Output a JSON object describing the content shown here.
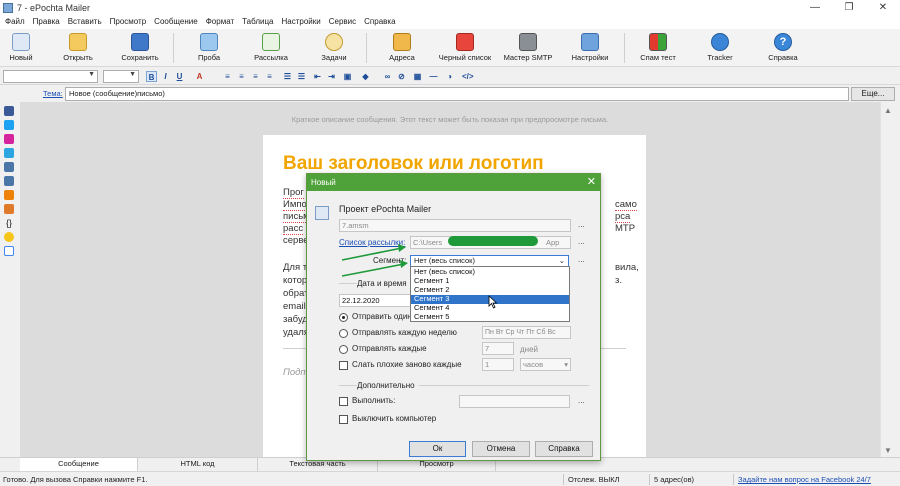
{
  "window": {
    "title": "7 - ePochta Mailer",
    "controls": [
      "—",
      "❐",
      "✕"
    ]
  },
  "menu": [
    "Файл",
    "Правка",
    "Вставить",
    "Просмотр",
    "Сообщение",
    "Формат",
    "Таблица",
    "Настройки",
    "Сервис",
    "Справка"
  ],
  "toolbar": {
    "new": "Новый",
    "open": "Открыть",
    "save": "Сохранить",
    "test": "Проба",
    "send": "Рассылка",
    "tasks": "Задачи",
    "addresses": "Адреса",
    "blacklist": "Черный список",
    "smtp": "Мастер SMTP",
    "settings": "Настройки",
    "spamtest": "Спам тест",
    "tracker": "Tracker",
    "help": "Справка"
  },
  "format": {
    "bold": "B",
    "italic": "I",
    "underline": "U",
    "font_color": "A"
  },
  "subject": {
    "label": "Тема:",
    "value": "Новое (сообщение)письмо)",
    "more": "Еще..."
  },
  "editor": {
    "preheader": "Краткое описание сообщения. Этот текст может быть показан при предпросмотре письма.",
    "heading": "Ваш заголовок или логотип",
    "left_fragments": [
      "Прог",
      "Импо",
      "письм",
      "расс",
      "серве",
      "Для т",
      "котор",
      "обрат",
      "email",
      "забуд",
      "удаля",
      "Подп"
    ],
    "right_fragments": [
      "само",
      "рса",
      "МТР",
      "вила,",
      "з."
    ]
  },
  "dialog": {
    "title": "Новый",
    "project_label": "Проект ePochta Mailer",
    "project_value": "7.amsm",
    "list_label": "Список рассылки:",
    "list_value_prefix": "C:\\Users",
    "list_value_suffix": "App",
    "segment_label": "Сегмент:",
    "segment_value": "Нет (весь список)",
    "segment_options": [
      "Нет (весь список)",
      "Сегмент 1",
      "Сегмент 2",
      "Сегмент 3",
      "Сегмент 4",
      "Сегмент 5"
    ],
    "segment_selected_index": 3,
    "datetime_label": "Дата и время",
    "date_value": "22.12.2020",
    "send_once": "Отправить один",
    "weekly": "Отправлять каждую неделю",
    "days": [
      "Пн",
      "Вт",
      "Ср",
      "Чт",
      "Пт",
      "Сб",
      "Вс"
    ],
    "every": "Отправлять каждые",
    "every_value": "7",
    "every_unit": "дней",
    "resend_bad": "Слать плохие заново каждые",
    "resend_value": "1",
    "resend_unit": "часов",
    "additional": "Дополнительно",
    "execute": "Выполнить:",
    "shutdown": "Выключить компьютер",
    "ok": "Ок",
    "cancel": "Отмена",
    "help": "Справка",
    "ellipsis": "..."
  },
  "tabs": [
    "Сообщение",
    "HTML код",
    "Текстовая часть",
    "Просмотр"
  ],
  "status": {
    "ready": "Готово. Для вызова Справки нажмите F1.",
    "tracking": "Отслеж. ВЫКЛ",
    "addresses": "5 адрес(ов)",
    "facebook_link": "Задайте нам вопрос на Facebook 24/7"
  },
  "colors": {
    "dialog_title": "#4fa13a",
    "heading": "#f0a500",
    "selection": "#2f74c8",
    "link": "#1c4fb5"
  }
}
